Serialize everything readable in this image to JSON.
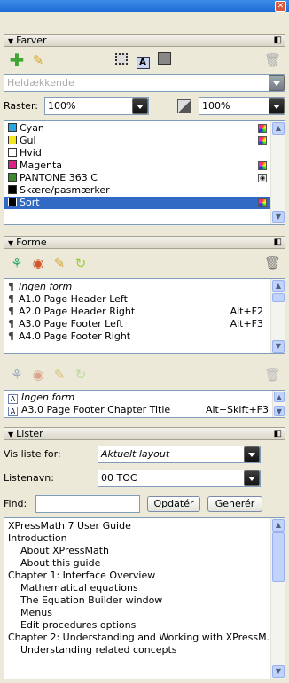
{
  "farver": {
    "title": "Farver",
    "fill_style": "Heldækkende",
    "raster_label": "Raster:",
    "raster_value": "100%",
    "raster_value2": "100%",
    "colors": [
      {
        "name": "Cyan",
        "swatch": "#2aa7e0",
        "model": "rgb"
      },
      {
        "name": "Gul",
        "swatch": "#f3e81f",
        "model": "rgb"
      },
      {
        "name": "Hvid",
        "swatch": "#ffffff",
        "model": ""
      },
      {
        "name": "Magenta",
        "swatch": "#e0218a",
        "model": "rgb"
      },
      {
        "name": "PANTONE 363 C",
        "swatch": "#3c8a2e",
        "model": "spot"
      },
      {
        "name": "Skære/pasmærker",
        "swatch": "#000000",
        "model": ""
      },
      {
        "name": "Sort",
        "swatch": "#000000",
        "model": "rgb",
        "selected": true
      }
    ]
  },
  "forme": {
    "title": "Forme",
    "paragraph_styles": [
      {
        "name": "Ingen form",
        "shortcut": "",
        "italic": true
      },
      {
        "name": "A1.0 Page Header Left",
        "shortcut": ""
      },
      {
        "name": "A2.0 Page Header Right",
        "shortcut": "Alt+F2"
      },
      {
        "name": "A3.0 Page Footer Left",
        "shortcut": "Alt+F3"
      },
      {
        "name": "A4.0 Page Footer Right",
        "shortcut": ""
      }
    ],
    "character_styles": [
      {
        "name": "Ingen form",
        "shortcut": "",
        "italic": true
      },
      {
        "name": "A3.0 Page Footer Chapter Title",
        "shortcut": "Alt+Skift+F3"
      }
    ]
  },
  "lister": {
    "title": "Lister",
    "show_list_label": "Vis liste for:",
    "show_list_value": "Aktuelt layout",
    "list_name_label": "Listenavn:",
    "list_name_value": "00 TOC",
    "find_label": "Find:",
    "find_value": "",
    "update_button": "Opdatér",
    "generate_button": "Generér",
    "items": [
      {
        "text": "XPressMath 7 User Guide",
        "indent": 0
      },
      {
        "text": "Introduction",
        "indent": 0
      },
      {
        "text": "About XPressMath",
        "indent": 1
      },
      {
        "text": "About this guide",
        "indent": 1
      },
      {
        "text": "Chapter 1: Interface Overview",
        "indent": 0
      },
      {
        "text": "Mathematical equations",
        "indent": 1
      },
      {
        "text": "The Equation Builder window",
        "indent": 1
      },
      {
        "text": "Menus",
        "indent": 1
      },
      {
        "text": "Edit procedures options",
        "indent": 1
      },
      {
        "text": "Chapter 2: Understanding and Working with XPressM...",
        "indent": 0
      },
      {
        "text": "Understanding related concepts",
        "indent": 1
      }
    ]
  }
}
